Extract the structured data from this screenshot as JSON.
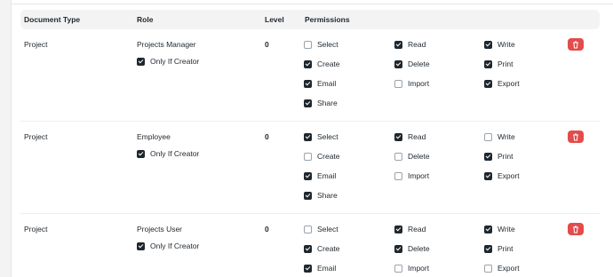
{
  "table": {
    "headers": {
      "document_type": "Document Type",
      "role": "Role",
      "level": "Level",
      "permissions": "Permissions"
    },
    "rows": [
      {
        "document_type": "Project",
        "role": "Projects Manager",
        "only_if_creator": {
          "label": "Only If Creator",
          "checked": true
        },
        "level": "0",
        "permissions": [
          {
            "label": "Select",
            "checked": false
          },
          {
            "label": "Read",
            "checked": true
          },
          {
            "label": "Write",
            "checked": true
          },
          {
            "label": "Create",
            "checked": true
          },
          {
            "label": "Delete",
            "checked": true
          },
          {
            "label": "Print",
            "checked": true
          },
          {
            "label": "Email",
            "checked": true
          },
          {
            "label": "Import",
            "checked": false
          },
          {
            "label": "Export",
            "checked": true
          },
          {
            "label": "Share",
            "checked": true
          }
        ]
      },
      {
        "document_type": "Project",
        "role": "Employee",
        "only_if_creator": {
          "label": "Only If Creator",
          "checked": true
        },
        "level": "0",
        "permissions": [
          {
            "label": "Select",
            "checked": true
          },
          {
            "label": "Read",
            "checked": true
          },
          {
            "label": "Write",
            "checked": false
          },
          {
            "label": "Create",
            "checked": false
          },
          {
            "label": "Delete",
            "checked": false
          },
          {
            "label": "Print",
            "checked": true
          },
          {
            "label": "Email",
            "checked": true
          },
          {
            "label": "Import",
            "checked": false
          },
          {
            "label": "Export",
            "checked": true
          },
          {
            "label": "Share",
            "checked": true
          }
        ]
      },
      {
        "document_type": "Project",
        "role": "Projects User",
        "only_if_creator": {
          "label": "Only If Creator",
          "checked": true
        },
        "level": "0",
        "permissions": [
          {
            "label": "Select",
            "checked": false
          },
          {
            "label": "Read",
            "checked": true
          },
          {
            "label": "Write",
            "checked": true
          },
          {
            "label": "Create",
            "checked": true
          },
          {
            "label": "Delete",
            "checked": true
          },
          {
            "label": "Print",
            "checked": true
          },
          {
            "label": "Email",
            "checked": true
          },
          {
            "label": "Import",
            "checked": false
          },
          {
            "label": "Export",
            "checked": false
          }
        ]
      }
    ]
  },
  "icons": {
    "delete": "trash-icon"
  },
  "colors": {
    "delete_button": "#e24c4c",
    "checked": "#1f272e",
    "header_bg": "#f3f3f3"
  }
}
